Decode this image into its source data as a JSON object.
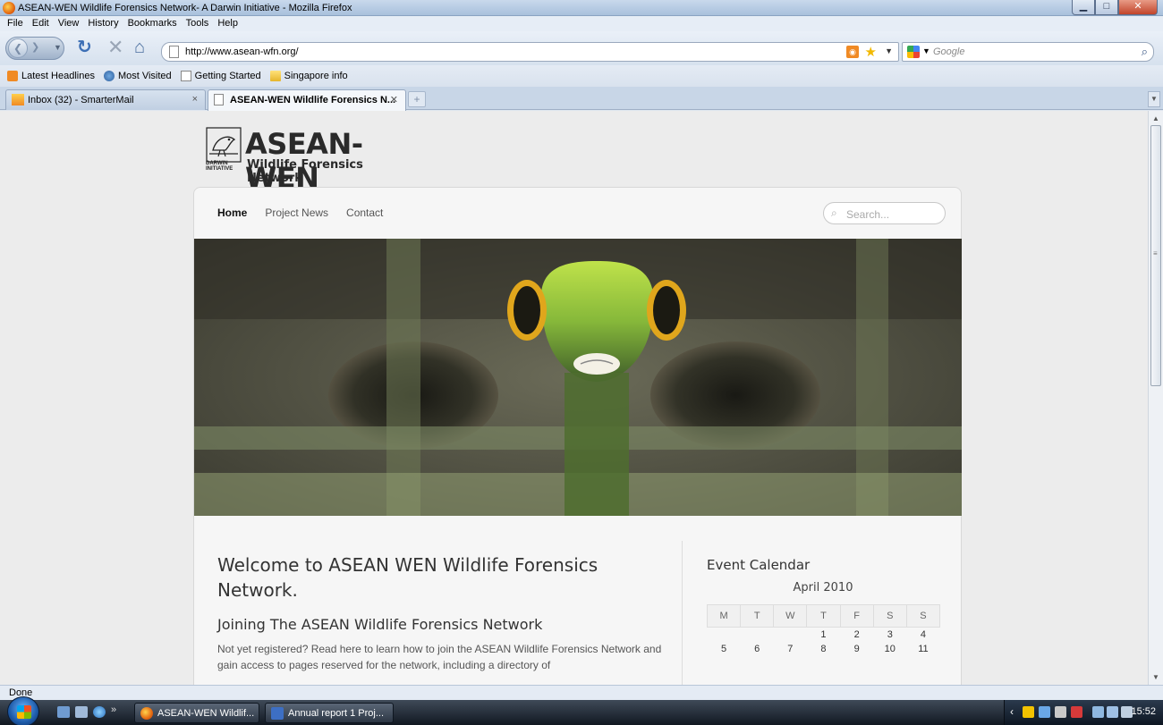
{
  "window": {
    "title": "ASEAN-WEN Wildlife Forensics Network- A Darwin Initiative - Mozilla Firefox",
    "min": "▁",
    "max": "□",
    "close": "✕"
  },
  "menu": [
    "File",
    "Edit",
    "View",
    "History",
    "Bookmarks",
    "Tools",
    "Help"
  ],
  "toolbar": {
    "url": "http://www.asean-wfn.org/",
    "search_placeholder": "Google"
  },
  "bookmarks": [
    "Latest Headlines",
    "Most Visited",
    "Getting Started",
    "Singapore info"
  ],
  "tabs": [
    {
      "label": "Inbox (32) - SmarterMail",
      "icon": "mail-icon"
    },
    {
      "label": "ASEAN-WEN Wildlife Forensics N...",
      "icon": "page-icon"
    }
  ],
  "tab_close": "×",
  "new_tab": "+",
  "site": {
    "logo_name": "ASEAN-WEN",
    "logo_sub": "Wildlife Forensics Network",
    "darwin_line1": "DARWIN",
    "darwin_line2": "INITIATIVE",
    "nav": [
      "Home",
      "Project News",
      "Contact"
    ],
    "search_placeholder": "Search...",
    "welcome_title": "Welcome to ASEAN WEN Wildlife Forensics Network.",
    "join_title": "Joining The ASEAN Wildlife Forensics Network",
    "join_text": "Not yet registered? Read here to learn how to join the ASEAN Wildlife Forensics Network and gain access to pages reserved for the network, including a directory of"
  },
  "calendar": {
    "title": "Event Calendar",
    "month": "April 2010",
    "weekdays": [
      "M",
      "T",
      "W",
      "T",
      "F",
      "S",
      "S"
    ],
    "rows": [
      [
        "",
        "",
        "",
        "1",
        "2",
        "3",
        "4"
      ],
      [
        "5",
        "6",
        "7",
        "8",
        "9",
        "10",
        "11"
      ]
    ]
  },
  "status": "Done",
  "taskbar": {
    "buttons": [
      "ASEAN-WEN Wildlif...",
      "Annual report 1 Proj..."
    ],
    "clock": "15:52",
    "more": "»"
  }
}
